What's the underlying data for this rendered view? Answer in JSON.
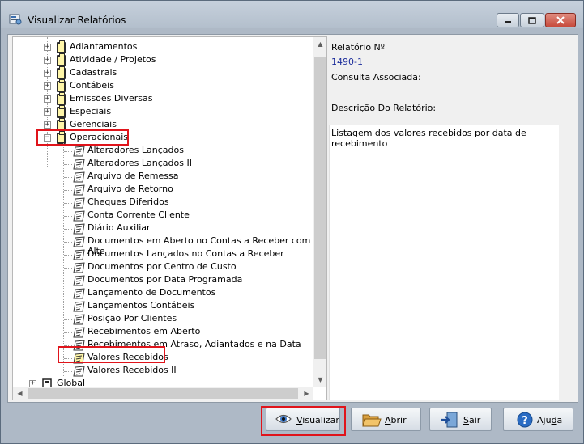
{
  "window": {
    "title": "Visualizar Relatórios",
    "controls": {
      "minimize": "minimize",
      "maximize": "maximize",
      "close": "close"
    }
  },
  "tree": {
    "groups_before": [
      {
        "label": "Adiantamentos",
        "expander": "+"
      },
      {
        "label": "Atividade / Projetos",
        "expander": "+"
      },
      {
        "label": "Cadastrais",
        "expander": "+"
      },
      {
        "label": "Contábeis",
        "expander": "+"
      },
      {
        "label": "Emissões Diversas",
        "expander": "+"
      },
      {
        "label": "Especiais",
        "expander": "+"
      },
      {
        "label": "Gerenciais",
        "expander": "+"
      }
    ],
    "open_group": {
      "label": "Operacionais",
      "expander": "−"
    },
    "children": [
      "Alteradores  Lançados",
      "Alteradores  Lançados II",
      "Arquivo de Remessa",
      "Arquivo de Retorno",
      "Cheques Diferidos",
      "Conta Corrente Cliente",
      "Diário  Auxiliar",
      "Documentos em Aberto no Contas a Receber com Alte",
      "Documentos Lançados no Contas a Receber",
      "Documentos por Centro de Custo",
      "Documentos por Data Programada",
      "Lançamento  de Documentos",
      "Lançamentos Contábeis",
      "Posição Por Clientes",
      "Recebimentos em Aberto",
      "Recebimentos em Atraso, Adiantados e na Data",
      "Valores Recebidos",
      "Valores Recebidos II"
    ],
    "selected_child": "Valores Recebidos",
    "root_after": {
      "label": "Global",
      "expander": "+"
    }
  },
  "details": {
    "report_number_label": "Relatório Nº",
    "report_number": "1490-1",
    "associated_query_label": "Consulta Associada:",
    "associated_query": "",
    "description_label": "Descrição Do Relatório:",
    "description": "Listagem dos valores recebidos por data de recebimento"
  },
  "buttons": {
    "view": {
      "pre": "",
      "u": "V",
      "post": "isualizar",
      "icon": "eye-icon"
    },
    "open": {
      "pre": "",
      "u": "A",
      "post": "brir",
      "icon": "folder-open-icon"
    },
    "exit": {
      "pre": "",
      "u": "S",
      "post": "air",
      "icon": "exit-door-icon"
    },
    "help": {
      "pre": "Aju",
      "u": "d",
      "post": "a",
      "icon": "help-icon"
    }
  },
  "colors": {
    "highlight": "#e0141b",
    "value_text": "#1a2b9a"
  }
}
